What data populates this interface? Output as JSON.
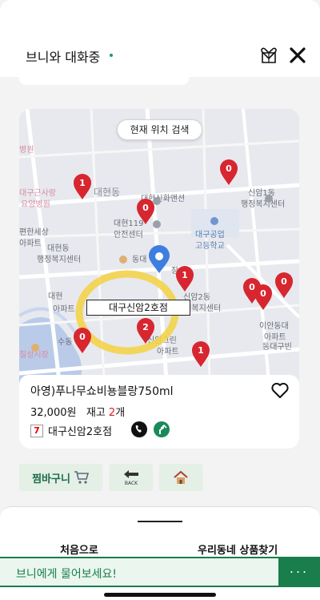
{
  "header": {
    "title": "브니와 대화중",
    "gift_icon": "gift-heart-icon",
    "close_icon": "close-icon"
  },
  "map": {
    "search_here_label": "현재 위치 검색",
    "selected_store_label": "대구신암2호점",
    "place_labels": [
      {
        "text": "대구근사랑",
        "color": "#d98aa0"
      },
      {
        "text": "요양병원",
        "color": "#d98aa0"
      },
      {
        "text": "대현동",
        "color": "#8a8f99"
      },
      {
        "text": "대현신화맨션",
        "color": "#6b6f78"
      },
      {
        "text": "신암1동",
        "color": "#6b6f78"
      },
      {
        "text": "행정복지센터",
        "color": "#6b6f78"
      },
      {
        "text": "대현119",
        "color": "#6b6f78"
      },
      {
        "text": "안전센터",
        "color": "#6b6f78"
      },
      {
        "text": "대구공업",
        "color": "#5a7fb0"
      },
      {
        "text": "고등학교",
        "color": "#5a7fb0"
      },
      {
        "text": "편한세상",
        "color": "#6b6f78"
      },
      {
        "text": "아파트",
        "color": "#6b6f78"
      },
      {
        "text": "대현동",
        "color": "#6b6f78"
      },
      {
        "text": "행정복지센터",
        "color": "#6b6f78"
      },
      {
        "text": "동대",
        "color": "#6b6f78"
      },
      {
        "text": "장",
        "color": "#6b6f78"
      },
      {
        "text": "신암2동",
        "color": "#6b6f78"
      },
      {
        "text": "행정복지센터",
        "color": "#6b6f78"
      },
      {
        "text": "대현",
        "color": "#6b6f78"
      },
      {
        "text": "아파트",
        "color": "#6b6f78"
      },
      {
        "text": "이안동대",
        "color": "#6b6f78"
      },
      {
        "text": "아파트",
        "color": "#6b6f78"
      },
      {
        "text": "신암그린",
        "color": "#6b6f78"
      },
      {
        "text": "아파트",
        "color": "#6b6f78"
      },
      {
        "text": "칠성시장",
        "color": "#d98aa0"
      },
      {
        "text": "수동",
        "color": "#6b6f78"
      },
      {
        "text": "동대구빈",
        "color": "#6b6f78"
      },
      {
        "text": "병원",
        "color": "#d98aa0"
      }
    ],
    "markers": [
      {
        "label": "1"
      },
      {
        "label": "0"
      },
      {
        "label": "0"
      },
      {
        "label": "1"
      },
      {
        "label": "0"
      },
      {
        "label": "0"
      },
      {
        "label": "0"
      },
      {
        "label": "2"
      },
      {
        "label": "0"
      },
      {
        "label": "1"
      }
    ],
    "colors": {
      "marker": "#d7262f",
      "highlight": "#f3d34a",
      "location_pin": "#3d7fe0"
    }
  },
  "product": {
    "name": "아영)푸나무쇼비뇽블랑750ml",
    "price": "32,000원",
    "stock_label": "재고",
    "stock_count": "2",
    "stock_unit": "개",
    "store_name": "대구신암2호점",
    "store_logo_text": "7",
    "heart_icon": "heart-outline-icon",
    "phone_icon": "phone-icon",
    "route_icon": "directions-icon"
  },
  "actions": {
    "basket_label": "찜바구니",
    "basket_icon": "cart-icon",
    "back_icon": "back-arrow-icon",
    "back_caption": "BACK",
    "home_icon": "home-icon"
  },
  "menu": {
    "first_label": "처음으로",
    "local_label": "우리동네 상품찾기"
  },
  "ask": {
    "placeholder": "브니에게 물어보세요!",
    "more_label": "..."
  }
}
